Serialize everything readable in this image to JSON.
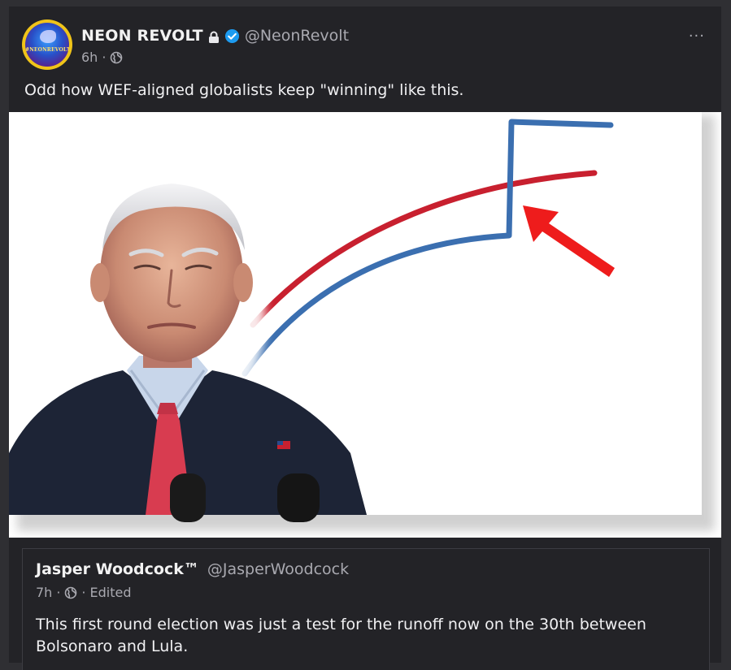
{
  "post": {
    "author": {
      "display_name": "NEON REVOLT",
      "handle": "@NeonRevolt",
      "avatar_text": "#NEONREVOLT",
      "locked_icon": "lock-icon",
      "verified_icon": "verified-badge-icon"
    },
    "time": "6h",
    "separator": "·",
    "visibility_icon": "globe-icon",
    "more_label": "···",
    "text": "Odd how WEF-aligned globalists keep \"winning\" like this."
  },
  "quote": {
    "author": {
      "display_name": "Jasper Woodcock™",
      "handle": "@JasperWoodcock"
    },
    "time": "7h",
    "separator": "·",
    "edited_label": "Edited",
    "text": "This first round election was just a test for the runoff now on the 30th between Bolsonaro and Lula."
  },
  "colors": {
    "background": "#2f2f33",
    "card": "#232327",
    "accent_blue": "#1d9bf0",
    "line_red": "#c8202f",
    "line_blue": "#3b6fb0",
    "arrow_red": "#ee1c1c"
  }
}
